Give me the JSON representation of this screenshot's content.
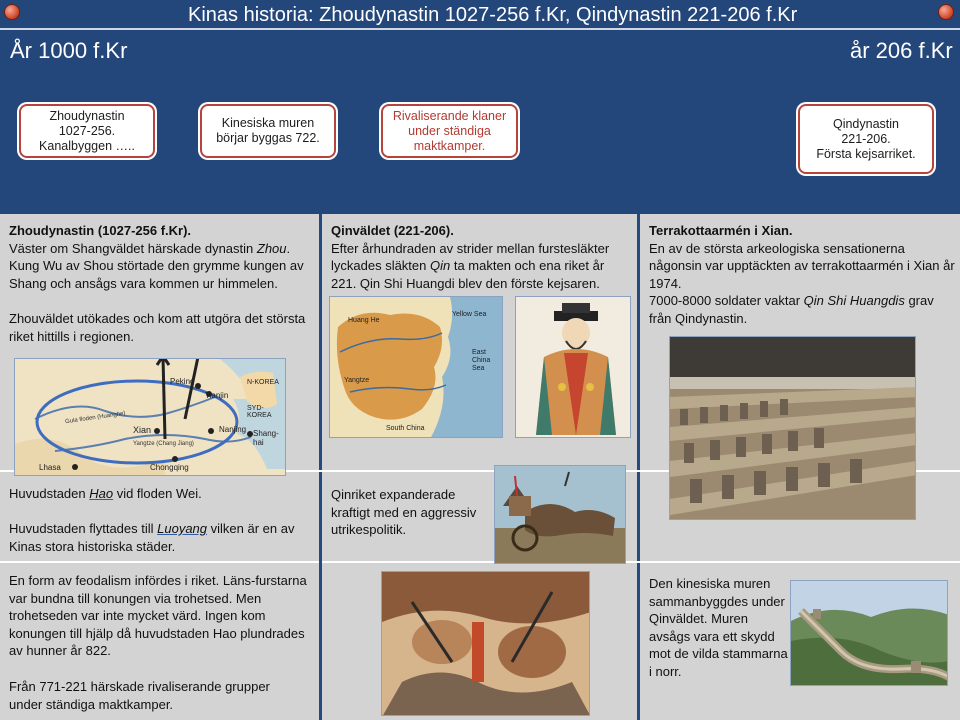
{
  "header": {
    "title": "Kinas historia: Zhoudynastin 1027-256 f.Kr, Qindynastin 221-206 f.Kr",
    "year_start": "År 1000 f.Kr",
    "year_end": "år 206 f.Kr"
  },
  "timeline": {
    "events": [
      {
        "text": "Zhoudynastin\n1027-256.\nKanalbyggen ….."
      },
      {
        "text": "Kinesiska muren\nbörjar byggas 722."
      },
      {
        "text": "Rivaliserande klaner\nunder ständiga\nmaktkamper."
      },
      {
        "text": "Qindynastin\n221-206.\nFörsta kejsarriket."
      }
    ]
  },
  "zhou": {
    "heading": "Zhoudynastin (1027-256 f.Kr).",
    "p1_pre": "Väster om Shangväldet härskade dynastin ",
    "p1_em": "Zhou",
    "p1_post": ".",
    "p2": "Kung Wu av Shou störtade den grymme kungen av Shang och ansågs vara kommen ur himmelen.",
    "p3": "Zhouväldet utökades och kom att utgöra det största  riket hittills i regionen.",
    "map_labels": {
      "beijing": "Peking",
      "tianjin": "Tianjin",
      "nkorea": "N-KOREA",
      "skorea": "SYD-KOREA",
      "xian": "Xian",
      "nanjing": "Nanjing",
      "shanghai": "Shang-hai",
      "lhasa": "Lhasa",
      "chongqing": "Chongqing",
      "yellow": "Gula floden (Huanghe)",
      "yangtze": "Yangtze (Chang Jiang)"
    },
    "capital_pre": "Huvudstaden ",
    "capital_em": "Hao",
    "capital_post": " vid floden Wei.",
    "moved_pre": "Huvudstaden flyttades till ",
    "moved_em": "Luoyang",
    "moved_post": " vilken är en av Kinas stora historiska städer.",
    "feudal": "En form av feodalism infördes i riket. Läns-furstarna var bundna till konungen via trohetsed. Men trohetseden var inte mycket värd. Ingen kom konungen till hjälp då huvudstaden Hao plundrades av hunner år 822.",
    "rivals": "Från 771-221 härskade rivaliserande grupper under ständiga maktkamper."
  },
  "qin": {
    "heading": "Qinväldet (221-206).",
    "p1_pre": "Efter århundraden av strider mellan furstesläkter lyckades släkten ",
    "p1_em": "Qin",
    "p1_post": " ta makten och ena riket år 221. Qin Shi Huangdi blev den förste kejsaren.",
    "map_labels": {
      "huanghe": "Huang He",
      "yellowsea": "Yellow Sea",
      "eastchina": "East China Sea",
      "southchina": "South China",
      "yangtze": "Yangtze"
    },
    "expand": "Qinriket expanderade kraftigt med en aggressiv utrikespolitik."
  },
  "terracotta": {
    "heading": "Terrakottaarmén i Xian.",
    "p1": "En av de största arkeologiska sensationerna någonsin var upptäckten av terrakottaarmén i Xian år 1974.",
    "p2_pre": "7000-8000 soldater vaktar ",
    "p2_em": "Qin Shi Huangdis",
    "p2_post": " grav från Qindynastin.",
    "wall": "Den kinesiska muren sammanbyggdes under Qinväldet. Muren avsågs vara  ett skydd mot de vilda stammarna i norr."
  }
}
